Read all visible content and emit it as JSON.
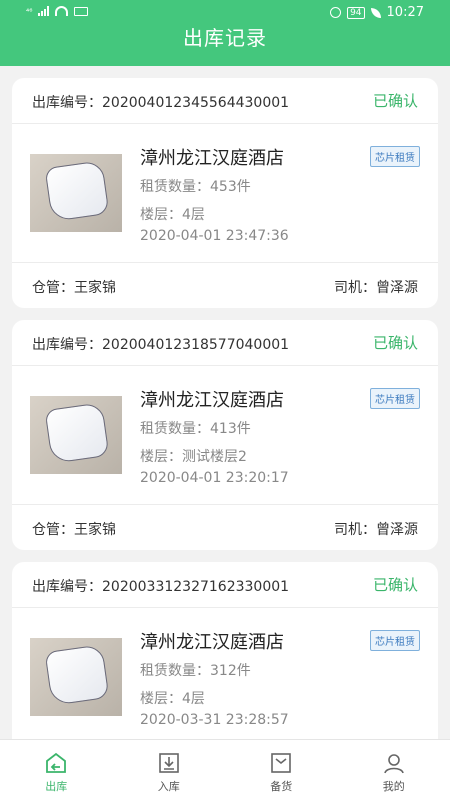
{
  "status_bar": {
    "carrier": "⁴⁶",
    "battery": "94",
    "time": "10:27"
  },
  "header": {
    "title": "出库记录"
  },
  "records": [
    {
      "order_label": "出库编号：",
      "order_no": "20200401234556443000​1",
      "status": "已确认",
      "hotel": "漳州龙江汉庭酒店",
      "tag": "芯片租赁",
      "quantity_line": "租赁数量：453件",
      "floor_line": "楼层：4层",
      "datetime": "2020-04-01 23:47:36",
      "keeper_line": "仓管：王家锦",
      "driver_line": "司机：曾泽源"
    },
    {
      "order_label": "出库编号：",
      "order_no": "20200401231857704000​1",
      "status": "已确认",
      "hotel": "漳州龙江汉庭酒店",
      "tag": "芯片租赁",
      "quantity_line": "租赁数量：413件",
      "floor_line": "楼层：测试楼层2",
      "datetime": "2020-04-01 23:20:17",
      "keeper_line": "仓管：王家锦",
      "driver_line": "司机：曾泽源"
    },
    {
      "order_label": "出库编号：",
      "order_no": "20200331232716233000​1",
      "status": "已确认",
      "hotel": "漳州龙江汉庭酒店",
      "tag": "芯片租赁",
      "quantity_line": "租赁数量：312件",
      "floor_line": "楼层：4层",
      "datetime": "2020-03-31 23:28:57",
      "keeper_line": "",
      "driver_line": ""
    }
  ],
  "tabs": [
    {
      "label": "出库",
      "icon": "outbound-icon",
      "active": true
    },
    {
      "label": "入库",
      "icon": "inbound-icon",
      "active": false
    },
    {
      "label": "备货",
      "icon": "stock-icon",
      "active": false
    },
    {
      "label": "我的",
      "icon": "profile-icon",
      "active": false
    }
  ],
  "colors": {
    "primary": "#44c77d",
    "confirmed": "#3bb56b",
    "tag": "#3d7bbf"
  }
}
